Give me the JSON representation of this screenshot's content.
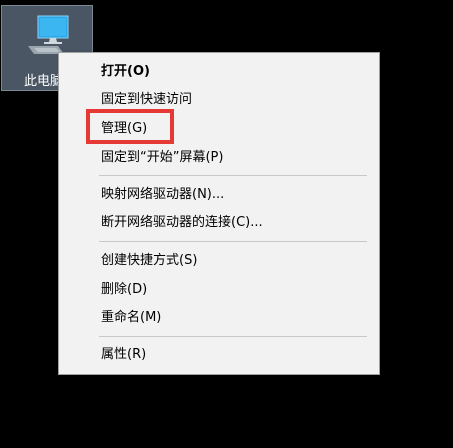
{
  "desktop": {
    "icon_label": "此电脑",
    "icon_name": "computer-monitor-icon"
  },
  "menu": {
    "items": [
      {
        "label": "打开(O)",
        "bold": true
      },
      {
        "label": "固定到快速访问"
      },
      {
        "label": "管理(G)"
      },
      {
        "label": "固定到“开始”屏幕(P)"
      },
      {
        "label": "映射网络驱动器(N)..."
      },
      {
        "label": "断开网络驱动器的连接(C)..."
      },
      {
        "label": "创建快捷方式(S)"
      },
      {
        "label": "删除(D)"
      },
      {
        "label": "重命名(M)"
      },
      {
        "label": "属性(R)"
      }
    ]
  },
  "colors": {
    "highlight": "#e53935",
    "menu_bg": "#f2f2f2",
    "desktop_bg": "#000000"
  }
}
